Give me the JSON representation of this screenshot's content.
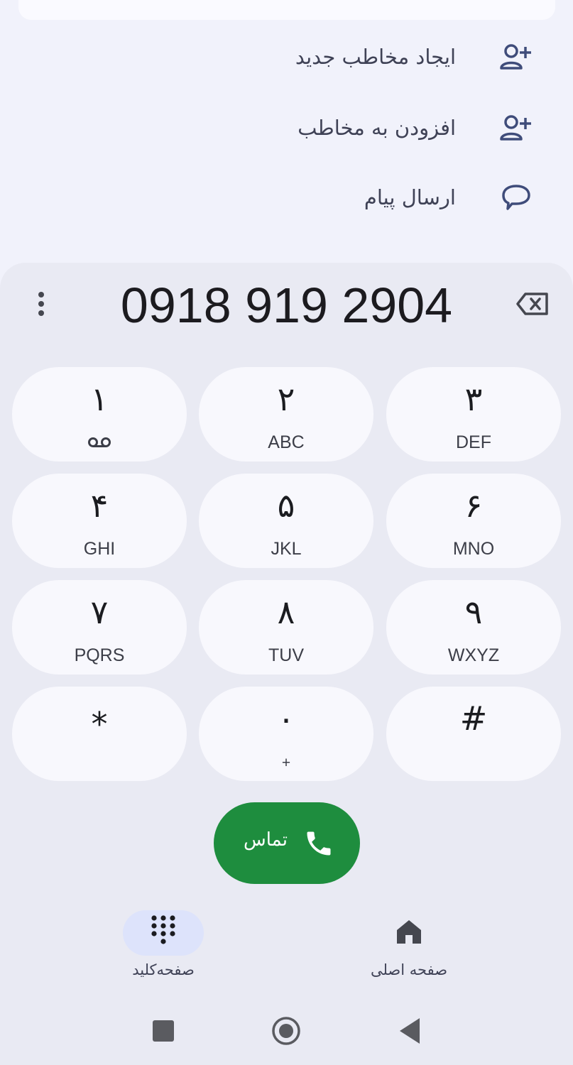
{
  "actions": [
    {
      "label": "ایجاد مخاطب جدید",
      "icon": "person-add-icon"
    },
    {
      "label": "افزودن به مخاطب",
      "icon": "person-add-icon"
    },
    {
      "label": "ارسال پیام",
      "icon": "message-icon"
    }
  ],
  "dialer": {
    "number": "0918 919 2904",
    "more_icon": "more-vert-icon",
    "backspace_icon": "backspace-icon"
  },
  "keys": [
    {
      "digit": "۱",
      "letters": "",
      "sub_icon": "voicemail-icon"
    },
    {
      "digit": "۲",
      "letters": "ABC"
    },
    {
      "digit": "۳",
      "letters": "DEF"
    },
    {
      "digit": "۴",
      "letters": "GHI"
    },
    {
      "digit": "۵",
      "letters": "JKL"
    },
    {
      "digit": "۶",
      "letters": "MNO"
    },
    {
      "digit": "۷",
      "letters": "PQRS"
    },
    {
      "digit": "۸",
      "letters": "TUV"
    },
    {
      "digit": "۹",
      "letters": "WXYZ"
    },
    {
      "digit": "*",
      "letters": ""
    },
    {
      "digit": "۰",
      "letters": "+"
    },
    {
      "digit": "#",
      "letters": ""
    }
  ],
  "call": {
    "label": "تماس",
    "icon": "phone-icon",
    "color": "#1e8d3e"
  },
  "nav": {
    "keypad_label": "صفحه‌کلید",
    "home_label": "صفحه اصلی",
    "keypad_icon": "dialpad-icon",
    "home_icon": "home-icon",
    "active_tab": "keypad",
    "active_color": "#dde3fb"
  },
  "system_nav": {
    "recents_icon": "square-icon",
    "home_icon": "circle-icon",
    "back_icon": "triangle-back-icon"
  }
}
